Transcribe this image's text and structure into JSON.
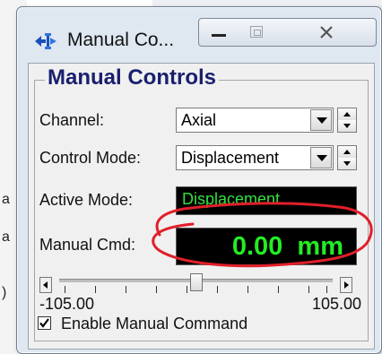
{
  "window": {
    "title": "Manual Co...",
    "icon": "arrows-move-icon"
  },
  "titlebar_buttons": {
    "minimize_icon": "minimize-icon",
    "maximize_icon": "maximize-icon",
    "close_icon": "close-icon"
  },
  "group": {
    "title": "Manual Controls"
  },
  "channel": {
    "label": "Channel:",
    "value": "Axial"
  },
  "control_mode": {
    "label": "Control Mode:",
    "value": "Displacement"
  },
  "active_mode": {
    "label": "Active Mode:",
    "value": "Displacement"
  },
  "manual_cmd": {
    "label": "Manual Cmd:",
    "value": "0.00",
    "unit": "mm"
  },
  "slider": {
    "min_label": "-105.00",
    "max_label": "105.00",
    "min": -105,
    "max": 105,
    "value": 0
  },
  "enable_manual": {
    "label": "Enable Manual Command",
    "checked": true
  },
  "background_fragments": {
    "left_chars": [
      "a",
      "a",
      ")"
    ]
  },
  "colors": {
    "lcd_text": "#22ee22",
    "lcd_bg": "#000000",
    "group_title": "#1a1f6e",
    "annotation": "#e0202a"
  }
}
